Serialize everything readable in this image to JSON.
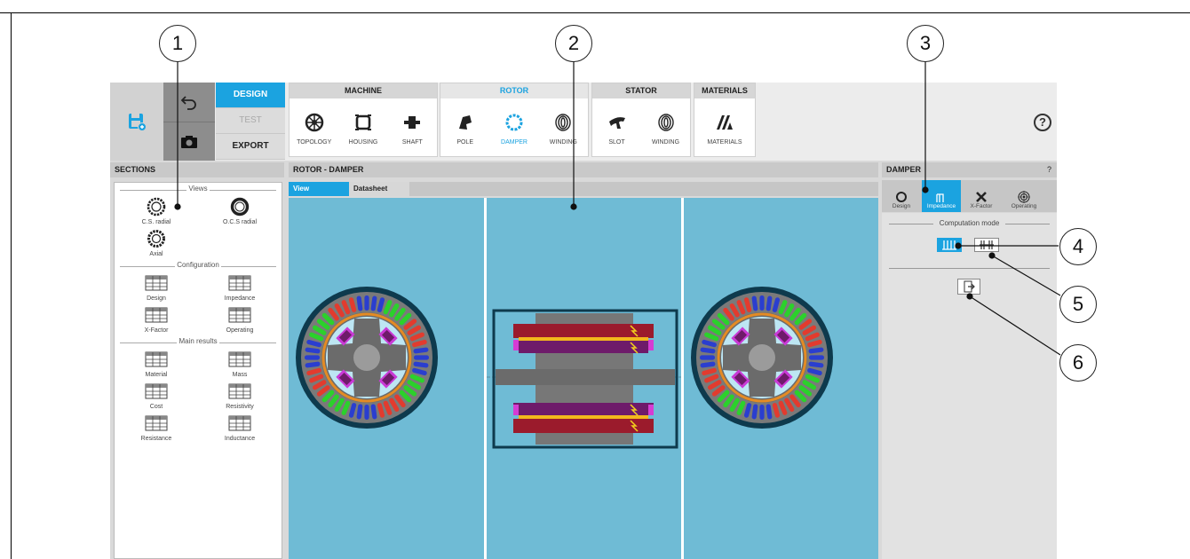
{
  "callouts": [
    "1",
    "2",
    "3",
    "4",
    "5",
    "6"
  ],
  "toolbar": {
    "modes": {
      "design": "DESIGN",
      "test": "TEST",
      "export": "EXPORT"
    },
    "groups": {
      "machine": {
        "title": "MACHINE",
        "items": [
          "TOPOLOGY",
          "HOUSING",
          "SHAFT"
        ]
      },
      "rotor": {
        "title": "ROTOR",
        "items": [
          "POLE",
          "DAMPER",
          "WINDING"
        ]
      },
      "stator": {
        "title": "STATOR",
        "items": [
          "SLOT",
          "WINDING"
        ]
      },
      "materials": {
        "title": "MATERIALS",
        "items": [
          "MATERIALS"
        ]
      }
    },
    "help": "?"
  },
  "sections": {
    "header": "SECTIONS",
    "views": {
      "title": "Views",
      "items": [
        "C.S. radial",
        "O.C.S radial",
        "Axial"
      ]
    },
    "configuration": {
      "title": "Configuration",
      "items": [
        "Design",
        "Impedance",
        "X-Factor",
        "Operating"
      ]
    },
    "main_results": {
      "title": "Main results",
      "items": [
        "Material",
        "Mass",
        "Cost",
        "Resistivity",
        "Resistance",
        "Inductance"
      ]
    }
  },
  "center": {
    "header": "ROTOR - DAMPER",
    "tabs": [
      "View",
      "Datasheet"
    ]
  },
  "damper": {
    "header": "DAMPER",
    "help": "?",
    "tabs": [
      "Design",
      "Impedance",
      "X-Factor",
      "Operating"
    ],
    "computation_mode": "Computation mode"
  },
  "colors": {
    "accent": "#1ba3e0",
    "view_bg": "#6fbbd5"
  }
}
